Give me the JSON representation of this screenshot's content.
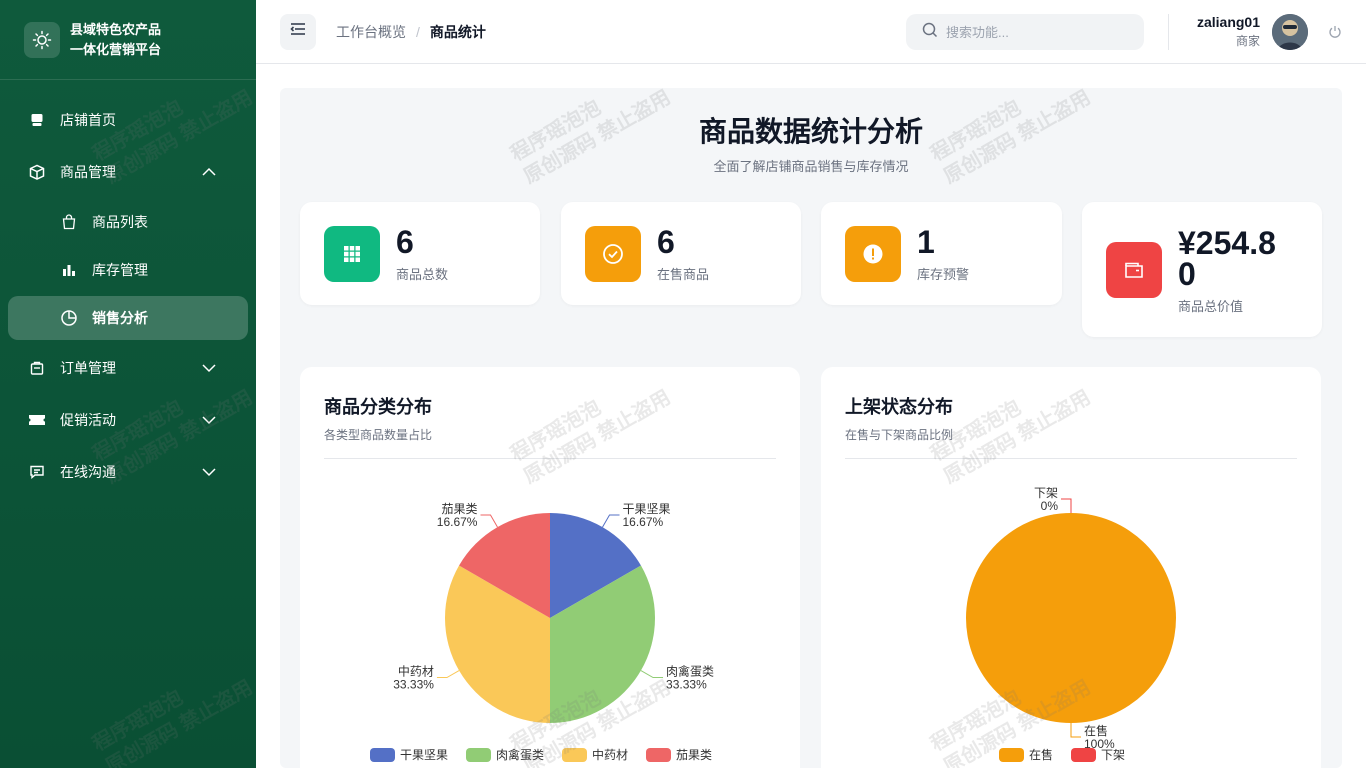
{
  "brand": {
    "line1": "县域特色农产品",
    "line2": "一体化营销平台",
    "icon": "sun-icon"
  },
  "menu": [
    {
      "label": "店铺首页",
      "icon": "store-icon"
    },
    {
      "label": "商品管理",
      "icon": "package-icon",
      "expanded": true
    },
    {
      "label": "订单管理",
      "icon": "clipboard-icon"
    },
    {
      "label": "促销活动",
      "icon": "ticket-icon"
    },
    {
      "label": "在线沟通",
      "icon": "chat-icon"
    }
  ],
  "submenu": [
    {
      "label": "商品列表",
      "icon": "shopping-bag-icon"
    },
    {
      "label": "库存管理",
      "icon": "bar-chart-icon"
    },
    {
      "label": "销售分析",
      "icon": "pie-chart-icon",
      "active": true
    }
  ],
  "header": {
    "breadcrumb": [
      "工作台概览",
      "商品统计"
    ],
    "breadcrumb_sep": "/",
    "search_placeholder": "搜索功能...",
    "user_name": "zaliang01",
    "user_role": "商家"
  },
  "page": {
    "title": "商品数据统计分析",
    "subtitle": "全面了解店铺商品销售与库存情况"
  },
  "stats": [
    {
      "value": "6",
      "label": "商品总数",
      "color": "#10b981",
      "icon": "grid-icon"
    },
    {
      "value": "6",
      "label": "在售商品",
      "color": "#f59e0b",
      "icon": "check-circle-icon"
    },
    {
      "value": "1",
      "label": "库存预警",
      "color": "#f59e0b",
      "icon": "alert-icon"
    },
    {
      "value_line1": "¥254.8",
      "value_line2": "0",
      "label": "商品总价值",
      "color": "#ef4444",
      "icon": "wallet-icon"
    }
  ],
  "cards": {
    "category": {
      "title": "商品分类分布",
      "subtitle": "各类型商品数量占比"
    },
    "status": {
      "title": "上架状态分布",
      "subtitle": "在售与下架商品比例"
    }
  },
  "watermark": {
    "line1": "程序瑶泡泡",
    "line2": "原创源码 禁止盗用"
  },
  "chart_data": [
    {
      "type": "pie",
      "categories": [
        "干果坚果",
        "肉禽蛋类",
        "中药材",
        "茄果类"
      ],
      "values": [
        16.67,
        33.33,
        33.33,
        16.67
      ],
      "labels": [
        "16.67%",
        "33.33%",
        "33.33%",
        "16.67%"
      ],
      "colors": [
        "#5470c6",
        "#91cc75",
        "#fac858",
        "#ee6666"
      ],
      "legend": "bottom"
    },
    {
      "type": "pie",
      "categories": [
        "在售",
        "下架"
      ],
      "values": [
        100,
        0
      ],
      "labels": [
        "100%",
        "0%"
      ],
      "colors": [
        "#f59e0b",
        "#ef4444"
      ],
      "legend": "bottom"
    }
  ]
}
